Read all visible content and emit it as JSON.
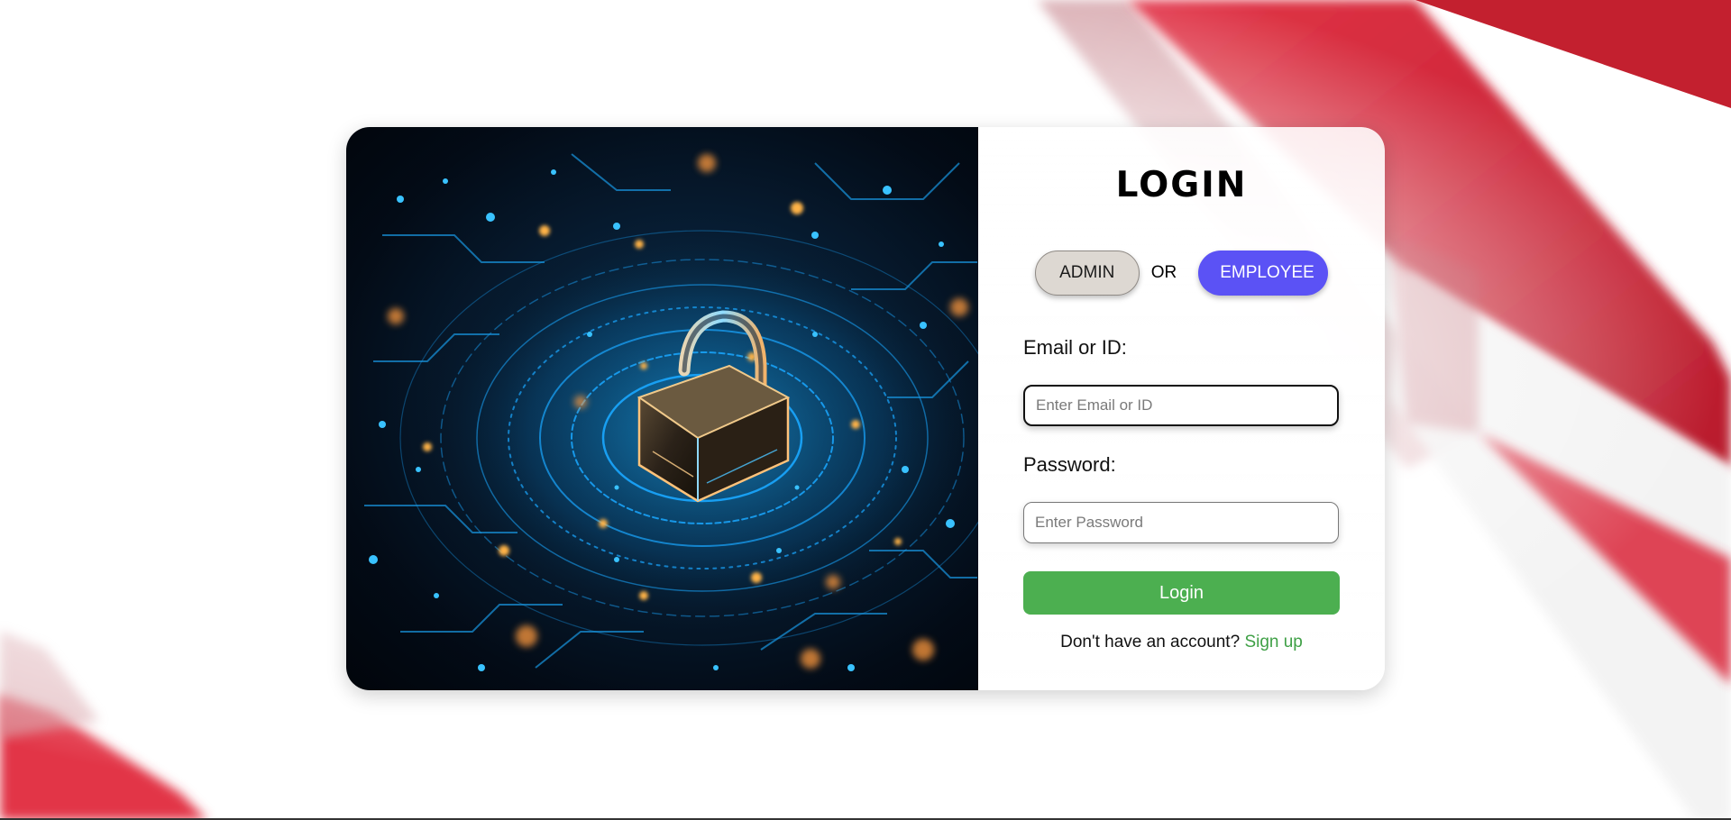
{
  "login": {
    "title": "LOGIN",
    "roles": {
      "admin_label": "ADMIN",
      "or_label": "OR",
      "employee_label": "EMPLOYEE",
      "selected": "EMPLOYEE"
    },
    "email_label": "Email or ID:",
    "email_placeholder": "Enter Email or ID",
    "password_label": "Password:",
    "password_placeholder": "Enter Password",
    "submit_label": "Login",
    "signup_prompt": "Don't have an account?",
    "signup_link": "Sign up"
  },
  "colors": {
    "accent_employee": "#5b52f5",
    "submit_green": "#4caf50",
    "signup_green": "#3fa046",
    "background_stripes_red": "#d12a3a"
  },
  "hero": {
    "icon": "padlock-icon"
  }
}
